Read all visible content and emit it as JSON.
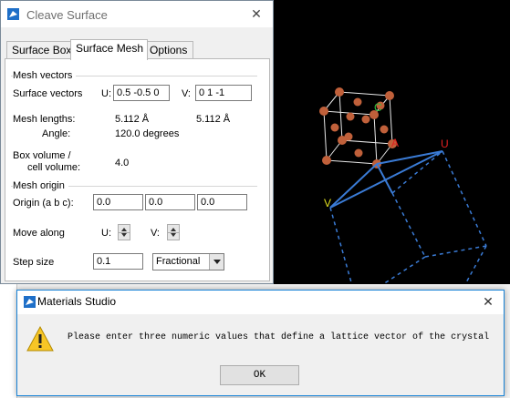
{
  "cleave_window": {
    "title": "Cleave Surface",
    "close_glyph": "✕",
    "tabs": [
      "Surface Box",
      "Surface Mesh",
      "Options"
    ],
    "active_tab": "Surface Mesh",
    "mesh_vectors_group": "Mesh vectors",
    "surface_vectors_label": "Surface vectors",
    "u_label": "U:",
    "u_value": "0.5 -0.5 0",
    "v_label": "V:",
    "v_value": "0  1  -1",
    "mesh_lengths_label": "Mesh lengths:",
    "mesh_length_u": "5.112 Å",
    "mesh_length_v": "5.112 Å",
    "angle_label": "Angle:",
    "angle_value": "120.0 degrees",
    "box_volume_label_1": "Box volume /",
    "box_volume_label_2": "cell volume:",
    "box_volume_value": "4.0",
    "mesh_origin_group": "Mesh origin",
    "origin_label": "Origin (a b c):",
    "origin_a": "0.0",
    "origin_b": "0.0",
    "origin_c": "0.0",
    "move_along_label": "Move along",
    "move_u_label": "U:",
    "move_v_label": "V:",
    "step_size_label": "Step size",
    "step_size_value": "0.1",
    "step_mode_value": "Fractional"
  },
  "viewport": {
    "axis_label_c": "C",
    "axis_label_a": "A",
    "mesh_label_u": "U",
    "mesh_label_v": "V",
    "atom_color": "#c0603a",
    "mesh_color": "#3a7bd5"
  },
  "message_box": {
    "title": "Materials Studio",
    "close_glyph": "✕",
    "icon": "warning-icon",
    "message": "Please enter three numeric values that define a lattice vector of the crystal",
    "ok_label": "OK"
  }
}
